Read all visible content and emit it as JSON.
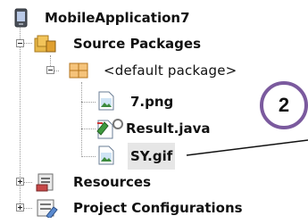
{
  "tree": {
    "project": "MobileApplication7",
    "source_packages": "Source Packages",
    "default_package": "<default package>",
    "files": [
      "7.png",
      "Result.java",
      "SY.gif"
    ],
    "resources": "Resources",
    "project_configurations": "Project Configurations"
  },
  "callout": {
    "number": "2"
  },
  "icons": {
    "project": "phone-project-icon",
    "source_packages": "folder-package-icon",
    "default_package": "package-icon",
    "png": "image-file-icon",
    "java": "java-file-icon",
    "gif": "image-file-icon",
    "resources": "resources-icon",
    "project_configurations": "configurations-icon"
  },
  "colors": {
    "callout_border": "#7b5a9e",
    "package": "#e0a030",
    "folder": "#e8b84a"
  }
}
